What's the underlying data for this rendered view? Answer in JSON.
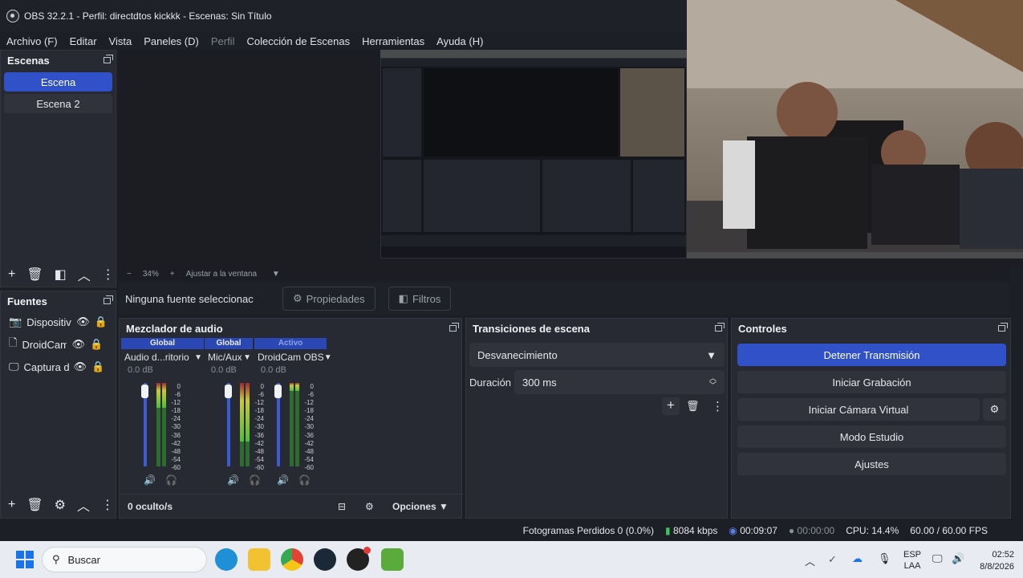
{
  "window": {
    "title": "OBS 32.2.1 - Perfil: directdtos kickkk - Escenas: Sin Título"
  },
  "menu": [
    "Archivo (F)",
    "Editar",
    "Vista",
    "Paneles (D)",
    "Perfil",
    "Colección de Escenas",
    "Herramientas",
    "Ayuda (H)"
  ],
  "scenes": {
    "title": "Escenas",
    "items": [
      {
        "label": "Escena",
        "active": true
      },
      {
        "label": "Escena 2",
        "active": false
      }
    ]
  },
  "zoom": {
    "minus": "−",
    "value": "34%",
    "plus": "+",
    "fit": "Ajustar a la ventana"
  },
  "propbar": {
    "no_source": "Ninguna fuente seleccionac",
    "properties": "Propiedades",
    "filters": "Filtros"
  },
  "sources": {
    "title": "Fuentes",
    "items": [
      {
        "label": "Dispositiv",
        "icon": "camera-icon"
      },
      {
        "label": "DroidCam",
        "icon": "file-icon"
      },
      {
        "label": "Captura d",
        "icon": "monitor-icon"
      }
    ]
  },
  "mixer": {
    "title": "Mezclador de audio",
    "channels": [
      {
        "head": "Global",
        "name": "Audio d...ritorio",
        "db": "0.0 dB",
        "level": 0.3
      },
      {
        "head": "Global",
        "name": "Mic/Aux",
        "db": "0.0 dB",
        "level": 0.7
      },
      {
        "head": "Activo",
        "name": "DroidCam OBS",
        "db": "0.0 dB",
        "level": 0.1
      }
    ],
    "scale": [
      "0",
      "-6",
      "-12",
      "-18",
      "-24",
      "-30",
      "-36",
      "-42",
      "-48",
      "-54",
      "-60"
    ],
    "footer": {
      "hidden": "0 oculto/s",
      "options": "Opciones"
    }
  },
  "transitions": {
    "title": "Transiciones de escena",
    "selected": "Desvanecimiento",
    "duration_label": "Duración",
    "duration_value": "300 ms"
  },
  "controls": {
    "title": "Controles",
    "stop_stream": "Detener Transmisión",
    "start_recording": "Iniciar Grabación",
    "start_virtual_cam": "Iniciar Cámara Virtual",
    "studio_mode": "Modo Estudio",
    "settings": "Ajustes"
  },
  "status": {
    "dropped": "Fotogramas Perdidos 0 (0.0%)",
    "bitrate": "8084 kbps",
    "stream_time": "00:09:07",
    "rec_time": "00:00:00",
    "cpu": "CPU: 14.4%",
    "fps": "60.00 / 60.00 FPS"
  },
  "taskbar": {
    "search_placeholder": "Buscar",
    "lang_top": "ESP",
    "lang_bottom": "LAA",
    "time": "02:52",
    "date": "8/8/2026"
  },
  "colors": {
    "accent": "#3051c8",
    "panel": "#272a33",
    "bg": "#1d1f26",
    "taskbar": "#e8ecf2"
  }
}
